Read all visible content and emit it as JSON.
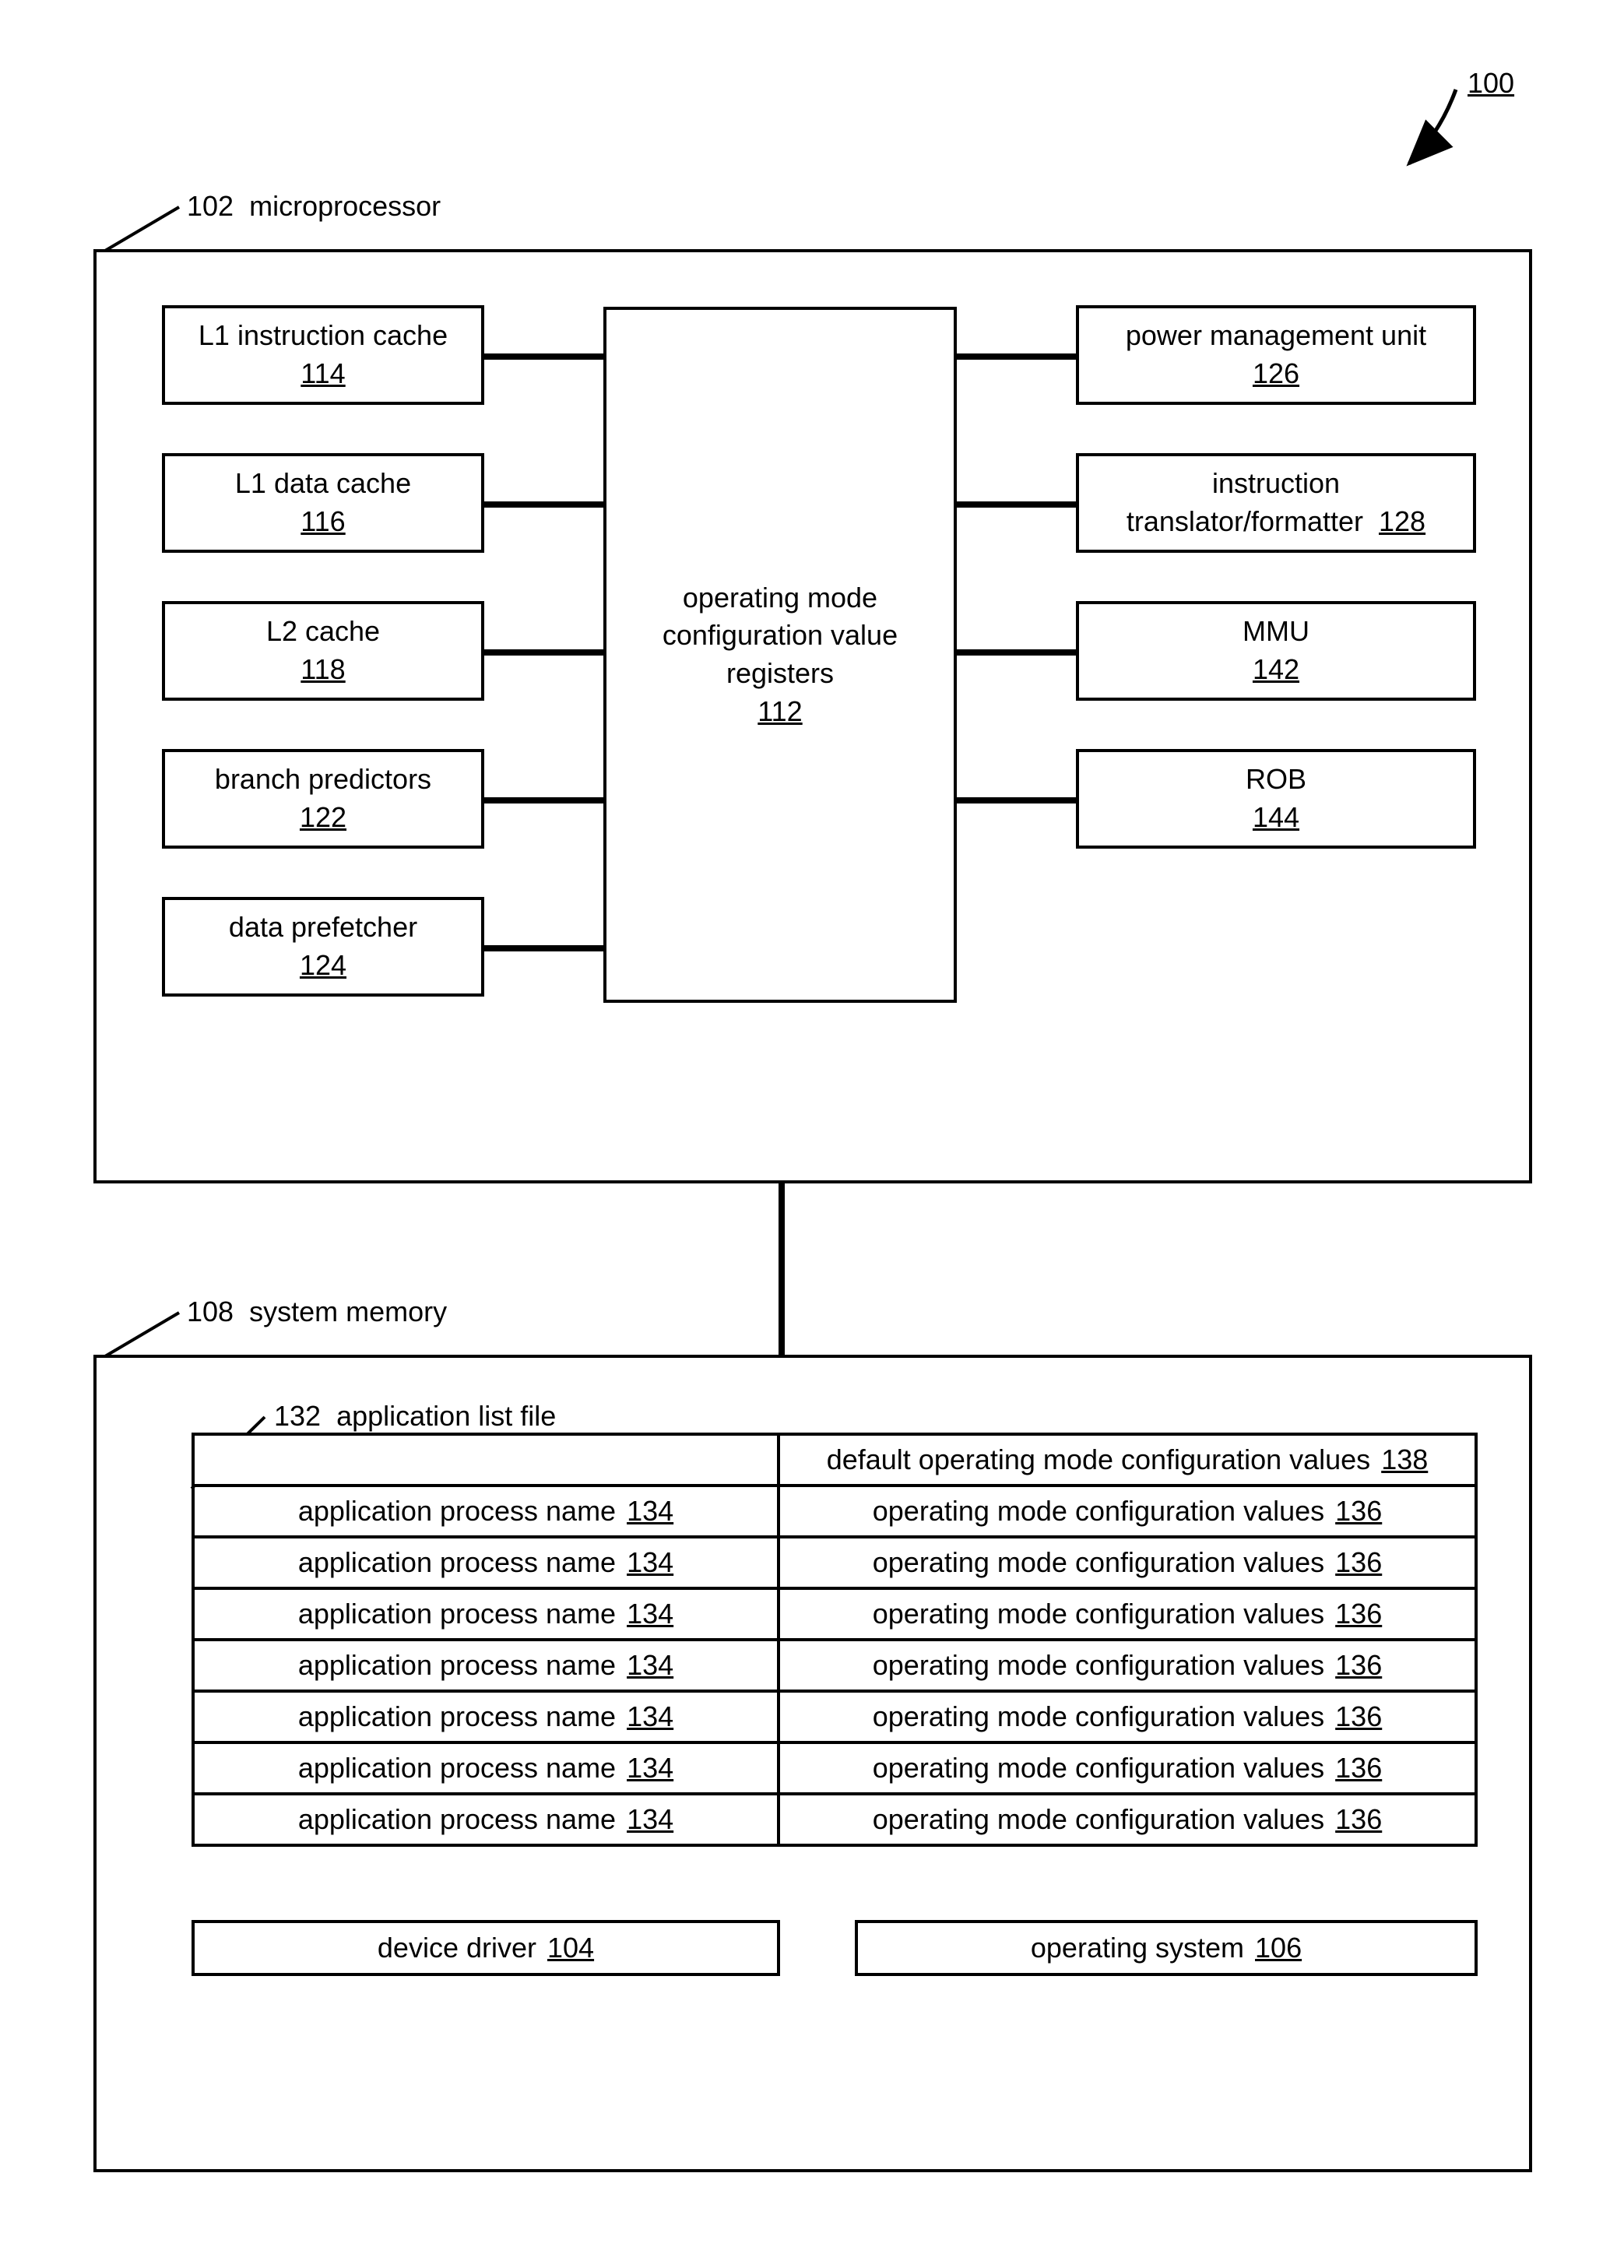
{
  "figure": {
    "ref": "100"
  },
  "microprocessor": {
    "label": "microprocessor",
    "ref": "102",
    "left_blocks": [
      {
        "name": "L1 instruction cache",
        "ref": "114"
      },
      {
        "name": "L1 data cache",
        "ref": "116"
      },
      {
        "name": "L2 cache",
        "ref": "118"
      },
      {
        "name": "branch predictors",
        "ref": "122"
      },
      {
        "name": "data prefetcher",
        "ref": "124"
      }
    ],
    "center": {
      "line1": "operating mode",
      "line2": "configuration value",
      "line3": "registers",
      "ref": "112"
    },
    "right_blocks": [
      {
        "name": "power management  unit",
        "ref": "126"
      },
      {
        "name_a": "instruction",
        "name_b": "translator/formatter",
        "ref": "128"
      },
      {
        "name": "MMU",
        "ref": "142"
      },
      {
        "name": "ROB",
        "ref": "144"
      }
    ]
  },
  "memory": {
    "label": "system memory",
    "ref": "108",
    "listfile": {
      "label": "application list file",
      "ref": "132"
    },
    "default_row": {
      "text": "default operating mode configuration values",
      "ref": "138"
    },
    "rows": [
      {
        "left": "application process name",
        "lref": "134",
        "right": "operating mode configuration values",
        "rref": "136"
      },
      {
        "left": "application process name",
        "lref": "134",
        "right": "operating mode configuration values",
        "rref": "136"
      },
      {
        "left": "application process name",
        "lref": "134",
        "right": "operating mode configuration values",
        "rref": "136"
      },
      {
        "left": "application process name",
        "lref": "134",
        "right": "operating mode configuration values",
        "rref": "136"
      },
      {
        "left": "application process name",
        "lref": "134",
        "right": "operating mode configuration values",
        "rref": "136"
      },
      {
        "left": "application process name",
        "lref": "134",
        "right": "operating mode configuration values",
        "rref": "136"
      },
      {
        "left": "application process name",
        "lref": "134",
        "right": "operating mode configuration values",
        "rref": "136"
      }
    ],
    "driver": {
      "text": "device driver",
      "ref": "104"
    },
    "os": {
      "text": "operating system",
      "ref": "106"
    }
  }
}
